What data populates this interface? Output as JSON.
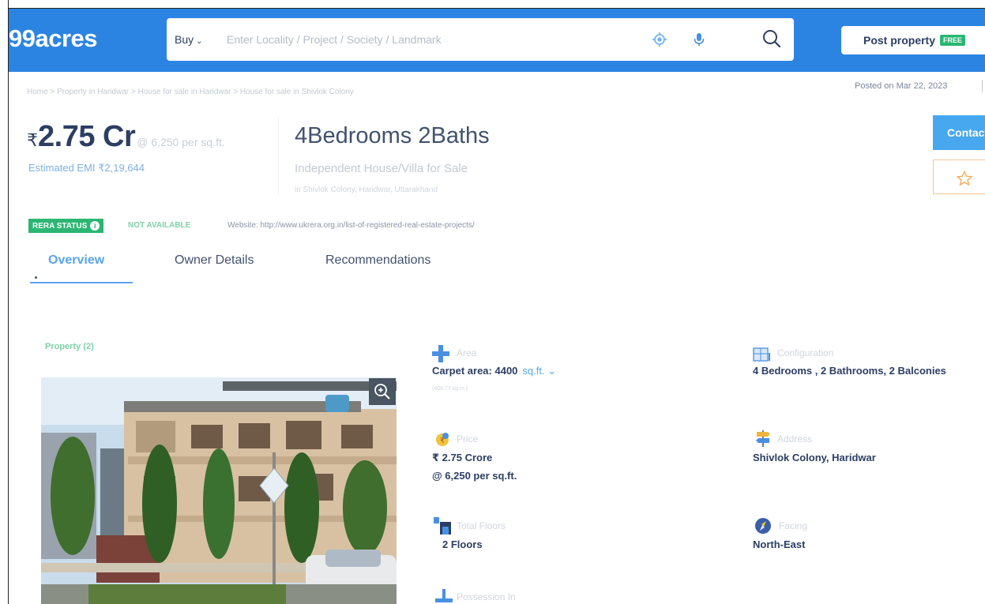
{
  "header": {
    "logo": "99acres",
    "search": {
      "mode": "Buy",
      "placeholder": "Enter Locality / Project / Society / Landmark"
    },
    "post_property": {
      "label": "Post property",
      "badge": "FREE"
    }
  },
  "breadcrumb": "Home > Property in Haridwar > House for sale in Haridwar > House for sale in Shivlok Colony",
  "posted": "Posted on Mar 22, 2023",
  "summary": {
    "currency": "₹",
    "price": "2.75 Cr",
    "per_sqft": "@ 6,250 per sq.ft.",
    "emi": "Estimated EMI ₹2,19,644",
    "config": "4Bedrooms 2Baths",
    "type": "Independent House/Villa for Sale",
    "location": "in Shivlok Colony, Haridwar, Uttarakhand"
  },
  "actions": {
    "contact_label": "Contact"
  },
  "rera": {
    "badge": "RERA STATUS",
    "value": "NOT AVAILABLE",
    "website": "Website: http://www.ukrera.org.in/list-of-registered-real-estate-projects/"
  },
  "tabs": [
    {
      "label": "Overview",
      "active": true
    },
    {
      "label": "Owner Details",
      "active": false
    },
    {
      "label": "Recommendations",
      "active": false
    }
  ],
  "photos": {
    "label": "Property (2)"
  },
  "facts": {
    "area": {
      "label": "Area",
      "value": "Carpet area: 4400",
      "unit": "sq.ft.",
      "sub": "(408.77 sq.m.)"
    },
    "configuration": {
      "label": "Configuration",
      "value": "4 Bedrooms , 2 Bathrooms, 2 Balconies"
    },
    "price": {
      "label": "Price",
      "value": "₹ 2.75 Crore",
      "sub": "@ 6,250 per sq.ft."
    },
    "address": {
      "label": "Address",
      "value": "Shivlok Colony, Haridwar"
    },
    "floors": {
      "label": "Total Floors",
      "value": "2 Floors"
    },
    "facing": {
      "label": "Facing",
      "value": "North-East"
    },
    "possession": {
      "label": "Possession In"
    }
  },
  "colors": {
    "brand_blue": "#2c84e2",
    "accent_green": "#2bb673",
    "link_blue": "#5aa4ec",
    "text_dark": "#2c3e63"
  }
}
